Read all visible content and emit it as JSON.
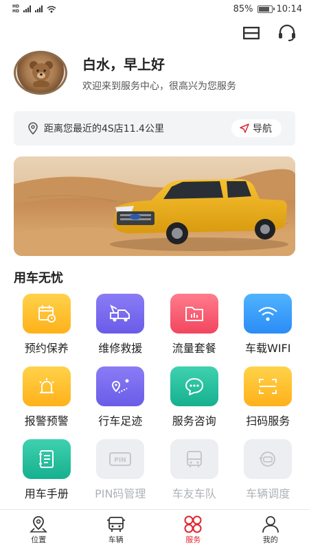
{
  "status_bar": {
    "sim1": "HD 4G",
    "sim2": "HD 4G",
    "battery_text": "85%",
    "battery_level": 0.85,
    "time": "10:14"
  },
  "header": {
    "menu_icon": "menu-icon",
    "service_icon": "headset-icon"
  },
  "greeting": {
    "title": "白水，早上好",
    "subtitle": "欢迎来到服务中心，很高兴为您服务"
  },
  "dealer": {
    "distance_text": "距离您最近的4S店11.4公里",
    "nav_label": "导航"
  },
  "section_title": "用车无忧",
  "services": [
    {
      "label": "预约保养",
      "icon": "calendar-icon",
      "color": "yellow",
      "enabled": true
    },
    {
      "label": "维修救援",
      "icon": "tow-truck-icon",
      "color": "purple",
      "enabled": true
    },
    {
      "label": "流量套餐",
      "icon": "data-folder-icon",
      "color": "red",
      "enabled": true
    },
    {
      "label": "车载WIFI",
      "icon": "wifi-icon",
      "color": "blue",
      "enabled": true
    },
    {
      "label": "报警预警",
      "icon": "alarm-light-icon",
      "color": "yellow",
      "enabled": true
    },
    {
      "label": "行车足迹",
      "icon": "route-icon",
      "color": "purple",
      "enabled": true
    },
    {
      "label": "服务咨询",
      "icon": "chat-icon",
      "color": "green",
      "enabled": true
    },
    {
      "label": "扫码服务",
      "icon": "scan-icon",
      "color": "yellow",
      "enabled": true
    },
    {
      "label": "用车手册",
      "icon": "manual-icon",
      "color": "green",
      "enabled": true
    },
    {
      "label": "PIN码管理",
      "icon": "pin-icon",
      "color": "gray",
      "enabled": false
    },
    {
      "label": "车友车队",
      "icon": "bus-icon",
      "color": "gray",
      "enabled": false
    },
    {
      "label": "车辆调度",
      "icon": "dispatch-icon",
      "color": "gray",
      "enabled": false
    }
  ],
  "bottom_nav": [
    {
      "label": "位置",
      "icon": "location-icon",
      "active": false
    },
    {
      "label": "车辆",
      "icon": "vehicle-icon",
      "active": false
    },
    {
      "label": "服务",
      "icon": "service-grid-icon",
      "active": true
    },
    {
      "label": "我的",
      "icon": "user-icon",
      "active": false
    }
  ],
  "colors": {
    "accent": "#e0262f",
    "yellow": "#ffb11a",
    "purple": "#6a5ce8",
    "red": "#f2465f",
    "blue": "#2b8cf5",
    "green": "#16b08e",
    "gray": "#eceef1"
  }
}
